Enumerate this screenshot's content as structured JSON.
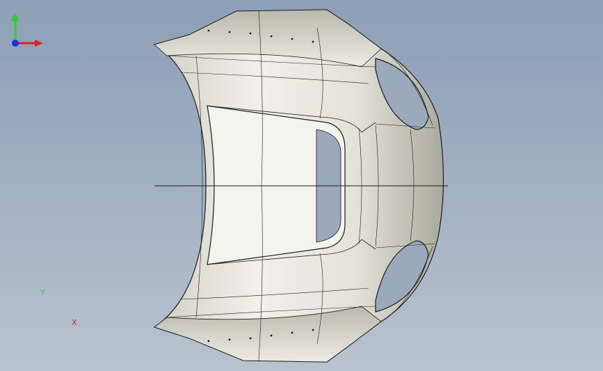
{
  "viewport": {
    "colors": {
      "background_top": "#8c9fb6",
      "background_bottom": "#b9c3cf",
      "part_fill": "#e7e7de",
      "edge": "#1a1a1a"
    },
    "model": {
      "name_icon": "car-hood-model"
    },
    "triad": {
      "x_label": "X",
      "y_label": "Y",
      "x_color": "#e02020",
      "y_color": "#2bd12b",
      "z_color": "#1a2ef0"
    }
  }
}
